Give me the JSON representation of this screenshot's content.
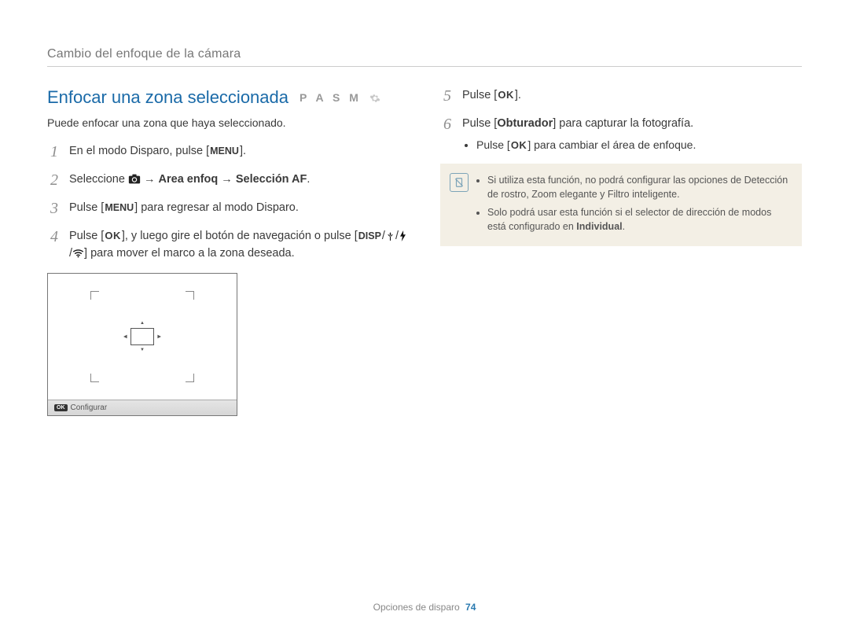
{
  "header": {
    "section": "Cambio del enfoque de la cámara"
  },
  "title": {
    "text": "Enfocar una zona seleccionada",
    "modes": "P A S M"
  },
  "intro": "Puede enfocar una zona que haya seleccionado.",
  "left_steps": {
    "n1": "1",
    "s1_a": "En el modo Disparo, pulse [",
    "s1_kbd": "MENU",
    "s1_b": "].",
    "n2": "2",
    "s2_a": "Seleccione ",
    "s2_arrow1": " → ",
    "s2_bold1": "Area enfoq",
    "s2_arrow2": " → ",
    "s2_bold2": "Selección AF",
    "s2_end": ".",
    "n3": "3",
    "s3_a": "Pulse [",
    "s3_kbd": "MENU",
    "s3_b": "] para regresar al modo Disparo.",
    "n4": "4",
    "s4_a": "Pulse [",
    "s4_ok": "OK",
    "s4_b": "], y luego gire el botón de navegación o pulse [",
    "s4_disp": "DISP",
    "s4_sep1": "/",
    "s4_sep2": "/",
    "s4_sep3": "/",
    "s4_c": "] para mover el marco a la zona deseada."
  },
  "lcd": {
    "bar_label": "Configurar"
  },
  "right_steps": {
    "n5": "5",
    "s5_a": "Pulse [",
    "s5_ok": "OK",
    "s5_b": "].",
    "n6": "6",
    "s6_a": "Pulse [",
    "s6_bold": "Obturador",
    "s6_b": "] para capturar la fotografía.",
    "sub_a": "Pulse [",
    "sub_ok": "OK",
    "sub_b": "] para cambiar el área de enfoque."
  },
  "note": {
    "b1": "Si utiliza esta función, no podrá configurar las opciones de Detección de rostro, Zoom elegante y Filtro inteligente.",
    "b2_a": "Solo podrá usar esta función si el selector de dirección de modos está configurado en ",
    "b2_bold": "Individual",
    "b2_b": "."
  },
  "footer": {
    "section": "Opciones de disparo",
    "page": "74"
  }
}
